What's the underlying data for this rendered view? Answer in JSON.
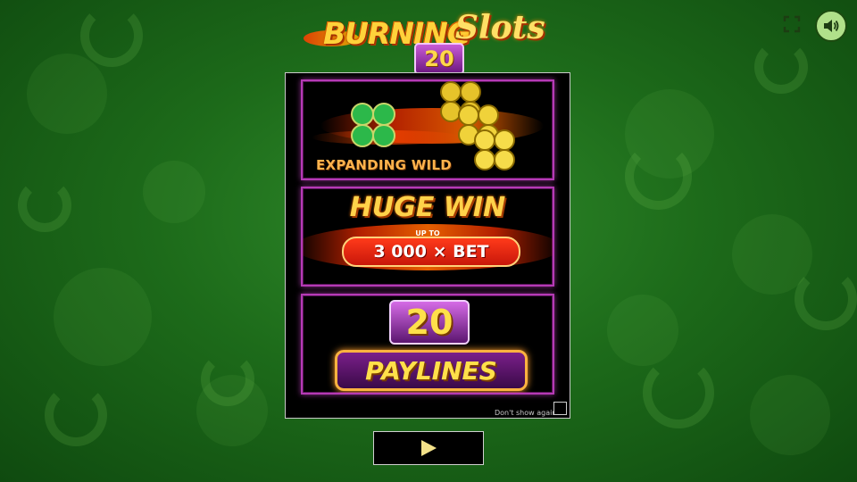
{
  "logo": {
    "word1": "BURNING",
    "word2": "Slots",
    "badge": "20"
  },
  "top_controls": {
    "fullscreen_icon": "fullscreen-icon",
    "sound_icon": "speaker-icon"
  },
  "features": {
    "expanding_wild": {
      "label": "EXPANDING WILD"
    },
    "huge_win": {
      "title": "HUGE WIN",
      "prefix": "UP TO",
      "amount": "3 000 × BET"
    },
    "paylines": {
      "count": "20",
      "label": "PAYLINES"
    }
  },
  "dont_show": {
    "label": "Don't show again",
    "checked": false
  },
  "play_button": {
    "icon": "play-icon"
  },
  "colors": {
    "accent_pink": "#b53ab5",
    "gold": "#ffd24a",
    "fire_red": "#ff3a1a",
    "felt_green": "#1d6b1a"
  }
}
